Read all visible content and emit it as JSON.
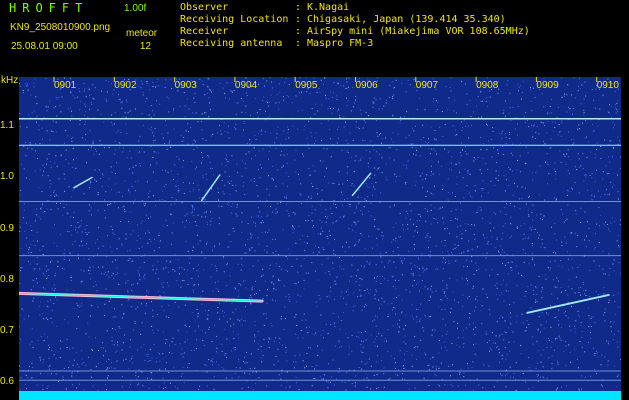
{
  "header": {
    "app_title": "HROFFT",
    "version": "1.00f",
    "filename": "KN9_2508010900.png",
    "datetime": "25.08.01 09:00",
    "meteor_label": "meteor",
    "meteor_count": "12",
    "info": [
      {
        "key": "Observer",
        "value": "K.Nagai"
      },
      {
        "key": "Receiving Location",
        "value": "Chigasaki, Japan (139.414 35.340)"
      },
      {
        "key": "Receiver",
        "value": "AirSpy mini (Miakejima VOR 108.65MHz)"
      },
      {
        "key": "Receiving antenna",
        "value": "Maspro FM-3"
      }
    ]
  },
  "chart_data": {
    "type": "heatmap",
    "title": "",
    "ylabel": "kHz",
    "x_ticks": [
      "0901",
      "0902",
      "0903",
      "0904",
      "0905",
      "0906",
      "0907",
      "0908",
      "0909",
      "0910"
    ],
    "y_ticks": [
      "1.1",
      "1.0",
      "0.9",
      "0.8",
      "0.7",
      "0.6"
    ],
    "ylim": [
      0.58,
      1.185
    ],
    "horizontal_lines_khz": [
      1.115,
      1.063,
      0.953,
      0.847,
      0.621,
      0.603
    ],
    "colors": {
      "background": "#102a8a",
      "noise": "#6f8fff",
      "line": "#9fe8ff",
      "axis_text": "#F2E500",
      "title": "#7CFC00",
      "bottom_band": "#00E5FF"
    },
    "echo_traces": [
      {
        "name": "",
        "from": [
          0,
          0.773
        ],
        "to": [
          3.45,
          0.758
        ]
      },
      {
        "name": "",
        "from": [
          7.85,
          0.735
        ],
        "to": [
          9.2,
          0.77
        ]
      },
      {
        "name": "",
        "from": [
          0.33,
          0.98
        ],
        "to": [
          0.63,
          1.0
        ]
      },
      {
        "name": "",
        "from": [
          2.45,
          0.955
        ],
        "to": [
          2.75,
          1.005
        ]
      },
      {
        "name": "",
        "from": [
          4.95,
          0.965
        ],
        "to": [
          5.25,
          1.008
        ]
      }
    ]
  }
}
